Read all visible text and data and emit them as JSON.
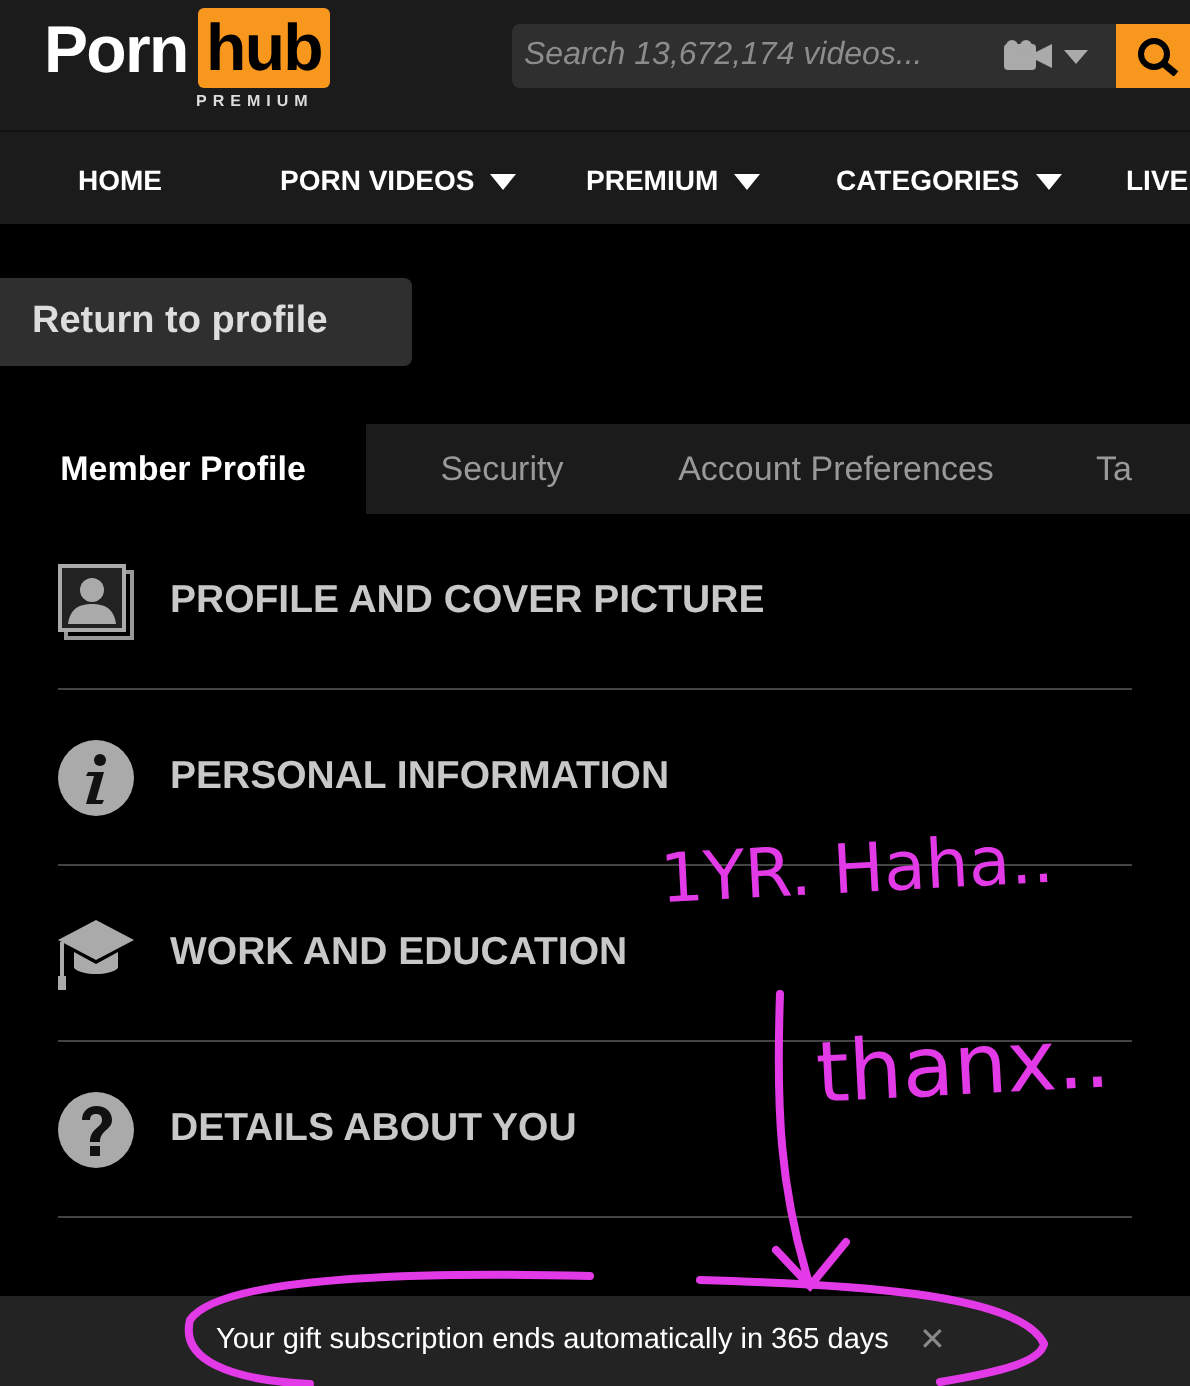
{
  "logo": {
    "left": "Porn",
    "right": "hub",
    "sub": "PREMIUM"
  },
  "search": {
    "placeholder": "Search 13,672,174 videos..."
  },
  "nav": [
    {
      "label": "HOME",
      "dropdown": false
    },
    {
      "label": "PORN VIDEOS",
      "dropdown": true
    },
    {
      "label": "PREMIUM",
      "dropdown": true
    },
    {
      "label": "CATEGORIES",
      "dropdown": true
    },
    {
      "label": "LIVE",
      "dropdown": false
    }
  ],
  "return_button": "Return to profile",
  "tabs": [
    {
      "label": "Member Profile",
      "selected": true
    },
    {
      "label": "Security",
      "selected": false
    },
    {
      "label": "Account Preferences",
      "selected": false
    },
    {
      "label": "Ta",
      "selected": false
    }
  ],
  "sections": [
    {
      "kind": "picture",
      "label": "PROFILE AND COVER PICTURE"
    },
    {
      "kind": "info",
      "label": "PERSONAL INFORMATION"
    },
    {
      "kind": "education",
      "label": "WORK AND EDUCATION"
    },
    {
      "kind": "details",
      "label": "DETAILS ABOUT YOU"
    }
  ],
  "notice": {
    "text": "Your gift subscription ends automatically in 365 days",
    "close": "✕"
  },
  "annotations": [
    {
      "text": "1YR. Haha.."
    },
    {
      "text": "thanx.."
    }
  ]
}
